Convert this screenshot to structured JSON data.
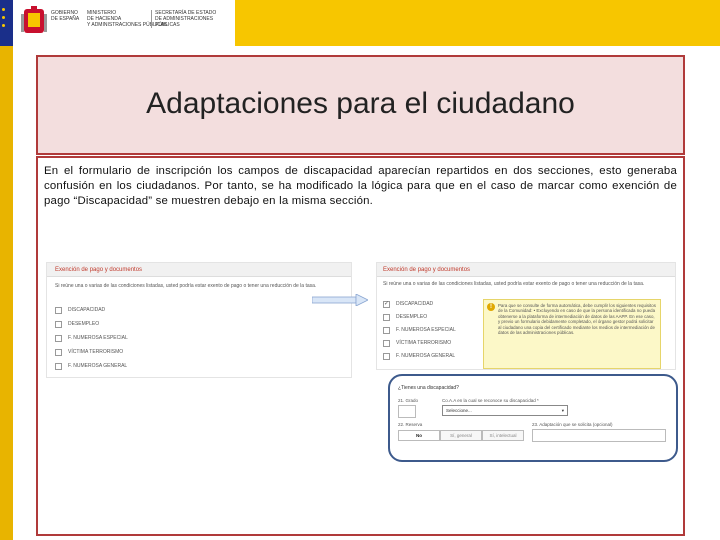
{
  "header": {
    "gov_line1": "GOBIERNO",
    "gov_line2": "DE ESPAÑA",
    "ministry_line1": "MINISTERIO",
    "ministry_line2": "DE HACIENDA",
    "ministry_line3": "Y ADMINISTRACIONES PÚBLICAS",
    "secretary_line1": "SECRETARÍA DE ESTADO",
    "secretary_line2": "DE ADMINISTRACIONES PÚBLICAS",
    "colors": {
      "band": "#f7c600",
      "flag_blue": "#1a2f8a",
      "border_red": "#b03a3a"
    }
  },
  "slide": {
    "title": "Adaptaciones para el ciudadano",
    "body": "En el formulario de inscripción  los campos de discapacidad aparecían repartidos en dos secciones, esto generaba confusión en los ciudadanos. Por tanto, se ha modificado la lógica para que en el caso de marcar como exención de pago “Discapacidad” se muestren debajo en la misma sección."
  },
  "left_form": {
    "panel_title": "Exención de pago y documentos",
    "note": "Si reúne una o varias de las condiciones listadas, usted podría estar exento de pago o tener una reducción de la tasa.",
    "options": [
      "DISCAPACIDAD",
      "DESEMPLEO",
      "F. NUMEROSA ESPECIAL",
      "VÍCTIMA TERRORISMO",
      "F. NUMEROSA GENERAL"
    ]
  },
  "right_form": {
    "panel_title": "Exención de pago y documentos",
    "note": "Si reúne una o varias de las condiciones listadas, usted podría estar exento de pago o tener una reducción de la tasa.",
    "options": [
      "DISCAPACIDAD",
      "DESEMPLEO",
      "F. NUMEROSA ESPECIAL",
      "VÍCTIMA TERRORISMO",
      "F. NUMEROSA GENERAL"
    ],
    "checked": "DISCAPACIDAD",
    "info_text": "Para que se consulte de forma automática, debe cumplir los siguientes requisitos de la Comunidad: • Excluyendo en caso de que la persona identificada no pueda obtenerse a la plataforma de intermediación de datos de las AAPP. En ese caso, y previo un formulario debidamente completado, el órgano gestor podrá solicitar al ciudadano una copia del certificado mediante los medios de intermediación de datos de las administraciones públicas."
  },
  "disability_form": {
    "question": "¿Tienes una discapacidad?",
    "grade_label": "21. Grado",
    "recognized_label": "Co.A.A en la cual se reconoce su discapacidad *",
    "select_value": "Seleccione...",
    "adaptation_label": "22. Reserva",
    "adaptation_detail_label": "23. Adaptación que se solicita (opcional)",
    "segments": [
      "No",
      "Sí, general",
      "Sí, intelectual"
    ],
    "segment_selected": "No"
  }
}
